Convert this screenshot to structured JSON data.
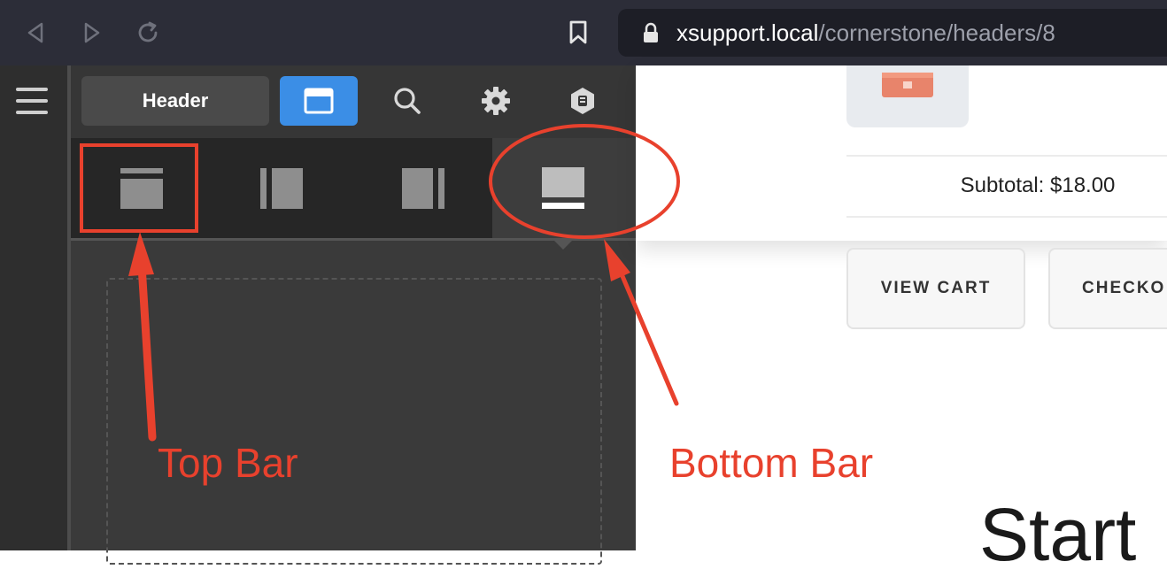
{
  "browser": {
    "back_icon": "back-arrow-icon",
    "forward_icon": "forward-arrow-icon",
    "reload_icon": "reload-icon",
    "bookmark_icon": "bookmark-icon",
    "lock_icon": "lock-icon",
    "url_host": "xsupport.local",
    "url_path": "/cornerstone/headers/8"
  },
  "sidebar": {
    "menu_icon": "hamburger-icon",
    "header_label": "Header",
    "tools": [
      {
        "name": "layout-icon",
        "active": true
      },
      {
        "name": "search-icon",
        "active": false
      },
      {
        "name": "gear-icon",
        "active": false
      },
      {
        "name": "plugin-badge-icon",
        "active": false
      }
    ],
    "bar_tabs": [
      {
        "name": "top-bar-icon"
      },
      {
        "name": "left-bar-icon"
      },
      {
        "name": "right-bar-icon"
      },
      {
        "name": "bottom-bar-icon",
        "active": true
      }
    ]
  },
  "preview": {
    "subtotal": "Subtotal: $18.00",
    "view_cart": "VIEW CART",
    "checkout": "CHECKO",
    "start_text": "Start"
  },
  "annotations": {
    "top_bar": "Top Bar",
    "bottom_bar": "Bottom Bar",
    "color": "#e8412d"
  },
  "colors": {
    "accent": "#3b8ee6",
    "panel": "#3a3a3a",
    "chrome": "#2c2d38"
  }
}
